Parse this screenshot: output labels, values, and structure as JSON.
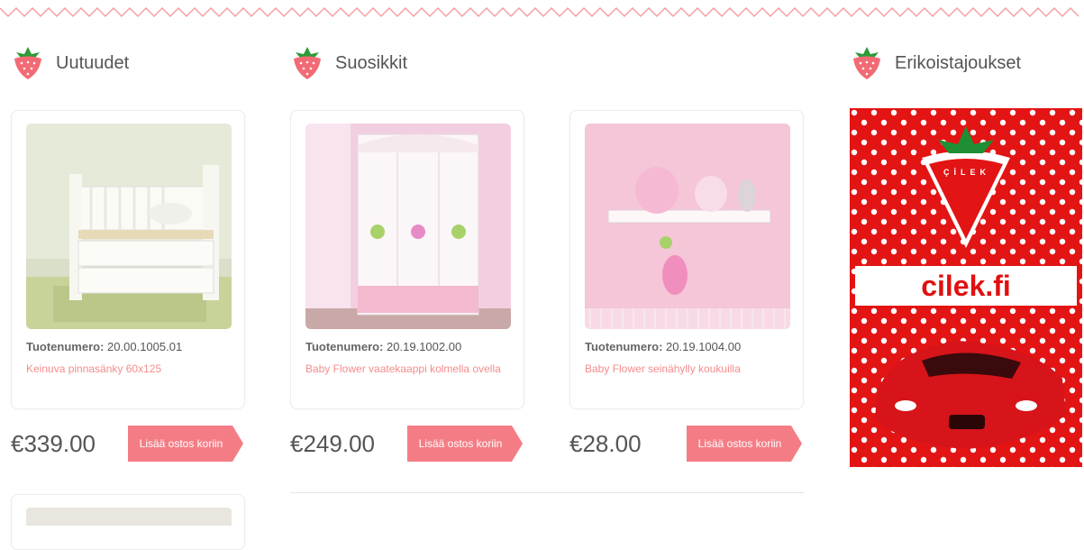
{
  "sections": {
    "new": "Uutuudet",
    "favorites": "Suosikkit",
    "specials": "Erikoistajoukset"
  },
  "products": [
    {
      "sku_label": "Tuotenumero:",
      "sku": "20.00.1005.01",
      "name": "Keinuva pinnasänky 60x125",
      "price": "€339.00",
      "button": "Lisää ostos koriin"
    },
    {
      "sku_label": "Tuotenumero:",
      "sku": "20.19.1002.00",
      "name": "Baby Flower vaatekaappi kolmella ovella",
      "price": "€249.00",
      "button": "Lisää ostos koriin"
    },
    {
      "sku_label": "Tuotenumero:",
      "sku": "20.19.1004.00",
      "name": "Baby Flower seinähylly koukuilla",
      "price": "€28.00",
      "button": "Lisää ostos koriin"
    }
  ],
  "banner": {
    "brand": "ÇİLEK",
    "site": "cilek.fi"
  },
  "colors": {
    "accent": "#f48c8c",
    "button": "#f47d85",
    "banner_red": "#e31414"
  }
}
